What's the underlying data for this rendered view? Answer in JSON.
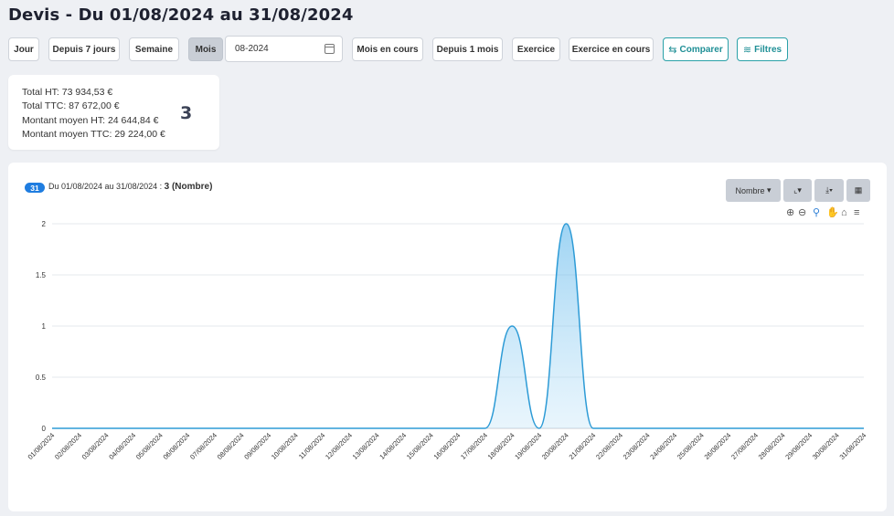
{
  "page": {
    "title": "Devis - Du 01/08/2024 au 31/08/2024"
  },
  "filters": {
    "buttons": [
      "Jour",
      "Depuis 7 jours",
      "Semaine",
      "Mois"
    ],
    "month_value": "08-2024",
    "buttons2": [
      "Mois en cours",
      "Depuis 1 mois",
      "Exercice",
      "Exercice en cours"
    ],
    "compare_label": "Comparer",
    "filters_label": "Filtres"
  },
  "summary": {
    "total_ht": "Total HT: 73 934,53 €",
    "total_ttc": "Total TTC: 87 672,00 €",
    "avg_ht": "Montant moyen HT: 24 644,84 €",
    "avg_ttc": "Montant moyen TTC: 29 224,00 €",
    "count": "3"
  },
  "panel": {
    "badge": "31",
    "range_text": "Du 01/08/2024 au 31/08/2024 : ",
    "count_text": "3 (Nombre)",
    "metric_label": "Nombre"
  },
  "colors": {
    "accent": "#2aa1a8",
    "line": "#2d9bd6",
    "badge": "#1f7de0"
  },
  "chart_data": {
    "type": "area",
    "x": [
      "01/08/2024",
      "02/08/2024",
      "03/08/2024",
      "04/08/2024",
      "05/08/2024",
      "06/08/2024",
      "07/08/2024",
      "08/08/2024",
      "09/08/2024",
      "10/08/2024",
      "11/08/2024",
      "12/08/2024",
      "13/08/2024",
      "14/08/2024",
      "15/08/2024",
      "16/08/2024",
      "17/08/2024",
      "18/08/2024",
      "19/08/2024",
      "20/08/2024",
      "21/08/2024",
      "22/08/2024",
      "23/08/2024",
      "24/08/2024",
      "25/08/2024",
      "26/08/2024",
      "27/08/2024",
      "28/08/2024",
      "29/08/2024",
      "30/08/2024",
      "31/08/2024"
    ],
    "values": [
      0,
      0,
      0,
      0,
      0,
      0,
      0,
      0,
      0,
      0,
      0,
      0,
      0,
      0,
      0,
      0,
      0,
      1,
      0,
      2,
      0,
      0,
      0,
      0,
      0,
      0,
      0,
      0,
      0,
      0,
      0
    ],
    "yticks": [
      "0",
      "0.5",
      "1",
      "1.5",
      "2"
    ],
    "ylim": [
      0,
      2
    ],
    "grid": true
  }
}
